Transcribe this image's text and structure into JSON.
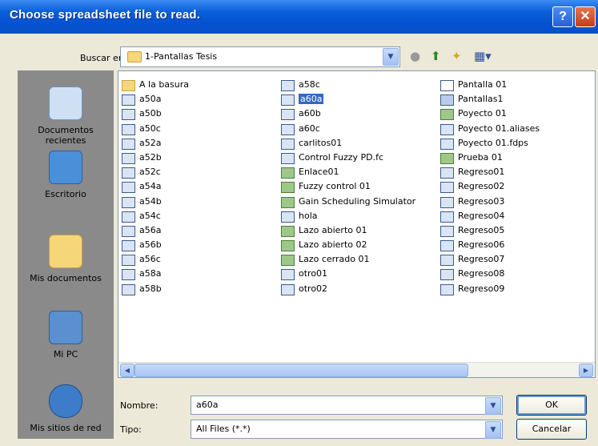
{
  "window": {
    "title": "Choose spreadsheet file to read."
  },
  "toolbar": {
    "look_in_label": "Buscar en:",
    "look_in_value": "1-Pantallas Tesis",
    "icons": [
      "back-icon",
      "up-folder-icon",
      "new-folder-icon",
      "view-menu-icon"
    ]
  },
  "places": [
    {
      "label": "Documentos recientes",
      "icon": "recent-docs-icon"
    },
    {
      "label": "Escritorio",
      "icon": "desktop-icon"
    },
    {
      "label": "Mis documentos",
      "icon": "my-documents-icon"
    },
    {
      "label": "Mi PC",
      "icon": "my-computer-icon"
    },
    {
      "label": "Mis sitios de red",
      "icon": "network-places-icon"
    }
  ],
  "files": {
    "col1": [
      "A la basura",
      "a50a",
      "a50b",
      "a50c",
      "a52a",
      "a52b",
      "a52c",
      "a54a",
      "a54b",
      "a54c",
      "a56a",
      "a56b",
      "a56c",
      "a58a",
      "a58b"
    ],
    "col2": [
      "a58c",
      "a60a",
      "a60b",
      "a60c",
      "carlitos01",
      "Control Fuzzy PD.fc",
      "Enlace01",
      "Fuzzy control 01",
      "Gain Scheduling Simulator",
      "hola",
      "Lazo abierto 01",
      "Lazo abierto 02",
      "Lazo cerrado 01",
      "otro01",
      "otro02"
    ],
    "col3": [
      "Pantalla 01",
      "Pantallas1",
      "Poyecto 01",
      "Poyecto 01.aliases",
      "Poyecto 01.fdps",
      "Prueba 01",
      "Regreso01",
      "Regreso02",
      "Regreso03",
      "Regreso04",
      "Regreso05",
      "Regreso06",
      "Regreso07",
      "Regreso08",
      "Regreso09"
    ],
    "selected": "a60a"
  },
  "form": {
    "name_label": "Nombre:",
    "name_value": "a60a",
    "type_label": "Tipo:",
    "type_value": "All Files (*.*)",
    "ok_label": "OK",
    "cancel_label": "Cancelar"
  }
}
